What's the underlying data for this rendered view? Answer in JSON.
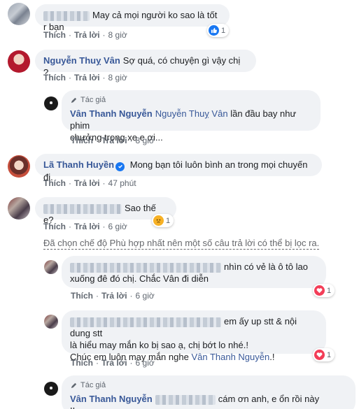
{
  "actions": {
    "like": "Thích",
    "reply": "Trả lời",
    "dot": "·"
  },
  "author_tag": "Tác giả",
  "filter_note": "Đã chọn chế độ Phù hợp nhất nên một số câu trả lời có thể bị lọc ra.",
  "comments": [
    {
      "text": "May cả mọi người ko sao là tốt r bạn",
      "time": "8 giờ",
      "reaction_count": "1",
      "reaction": "like"
    },
    {
      "name": "Nguyễn Thuỵ Vân",
      "text": "Sợ quá, có chuyện gì vậy chị ?",
      "time": "8 giờ"
    },
    {
      "name": "Vân Thanh Nguyễn",
      "mention": "Nguyễn Thuỵ Vân",
      "text": "lần đầu bay như phim",
      "text2": "chưởng trong xe e ơi...",
      "time": "8 giờ"
    },
    {
      "name": "Lã Thanh Huyền",
      "text": "Mong bạn tôi luôn bình an trong mọi chuyến đi.",
      "time": "47 phút"
    },
    {
      "text": "Sao thế e?",
      "time": "6 giờ",
      "reaction_count": "1",
      "reaction": "sad"
    },
    {
      "text": "nhìn có vẻ là ô tô lao",
      "text2": "xuống đê đó chị. Chắc Vân đi diễn",
      "time": "6 giờ",
      "reaction_count": "1",
      "reaction": "love"
    },
    {
      "text": "em ấy up stt & nội dung stt",
      "text2": "là hiểu may mắn ko bị sao ạ, chị bớt lo nhé.!",
      "text3": "Chúc em luôn may mắn nghe",
      "mention": "Vân Thanh Nguyễn",
      "text3_end": ".!",
      "time": "6 giờ",
      "reaction_count": "1",
      "reaction": "love"
    },
    {
      "name": "Vân Thanh Nguyễn",
      "text": "cám ơn anh, e ổn rồi này",
      "text2": "!!"
    }
  ],
  "colors": {
    "link": "#385898",
    "bubble": "#f0f2f5",
    "like": "#1877f2",
    "love": "#f33e58",
    "sad": "#f7b125"
  }
}
